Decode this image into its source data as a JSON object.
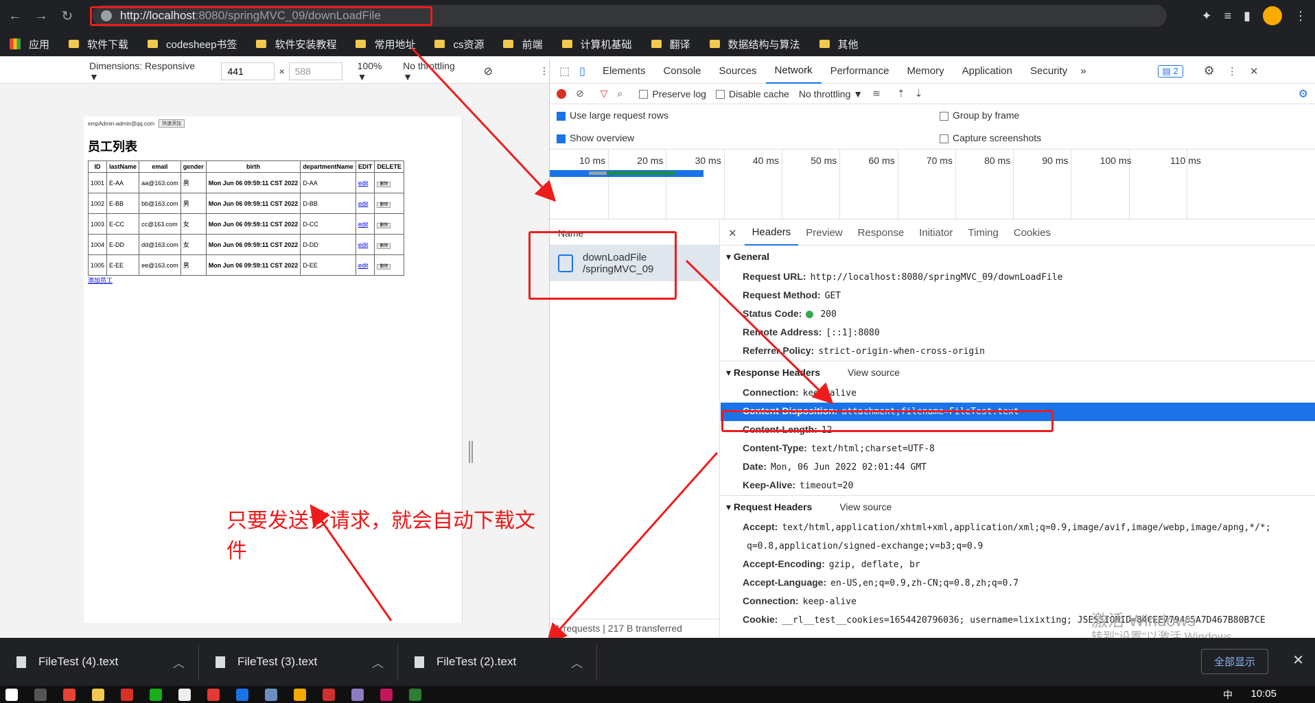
{
  "browser": {
    "url_host": "http://localhost",
    "url_rest": ":8080/springMVC_09/downLoadFile"
  },
  "bookmarks": [
    "应用",
    "软件下载",
    "codesheep书签",
    "软件安装教程",
    "常用地址",
    "cs资源",
    "前端",
    "计算机基础",
    "翻译",
    "数据结构与算法",
    "其他"
  ],
  "device_toolbar": {
    "dimensions": "Dimensions: Responsive ▼",
    "width": "441",
    "height": "588",
    "zoom": "100% ▼",
    "throttle": "No throttling ▼"
  },
  "page": {
    "user": "empAdmin-admin@qq.com",
    "quick_add": "快速添加",
    "title": "员工列表",
    "columns": [
      "ID",
      "lastName",
      "email",
      "gender",
      "birth",
      "departmentName",
      "EDIT",
      "DELETE"
    ],
    "rows": [
      [
        "1001",
        "E-AA",
        "aa@163.com",
        "男",
        "Mon Jun 06 09:59:11 CST 2022",
        "D-AA",
        "edit",
        "删除"
      ],
      [
        "1002",
        "E-BB",
        "bb@163.com",
        "男",
        "Mon Jun 06 09:59:11 CST 2022",
        "D-BB",
        "edit",
        "删除"
      ],
      [
        "1003",
        "E-CC",
        "cc@163.com",
        "女",
        "Mon Jun 06 09:59:11 CST 2022",
        "D-CC",
        "edit",
        "删除"
      ],
      [
        "1004",
        "E-DD",
        "dd@163.com",
        "女",
        "Mon Jun 06 09:59:11 CST 2022",
        "D-DD",
        "edit",
        "删除"
      ],
      [
        "1005",
        "E-EE",
        "ee@163.com",
        "男",
        "Mon Jun 06 09:59:11 CST 2022",
        "D-EE",
        "edit",
        "删除"
      ]
    ],
    "add_link": "添加员工"
  },
  "annotation": "只要发送该请求，就会自动下载文件",
  "devtools": {
    "tabs": [
      "Elements",
      "Console",
      "Sources",
      "Network",
      "Performance",
      "Memory",
      "Application",
      "Security"
    ],
    "active_tab": "Network",
    "issues_count": "2",
    "toolbar": {
      "preserve_log": "Preserve log",
      "disable_cache": "Disable cache",
      "throttle": "No throttling"
    },
    "options": {
      "large_rows": "Use large request rows",
      "show_overview": "Show overview",
      "group_by_frame": "Group by frame",
      "capture_screenshots": "Capture screenshots"
    },
    "timeline_ticks": [
      "10 ms",
      "20 ms",
      "30 ms",
      "40 ms",
      "50 ms",
      "60 ms",
      "70 ms",
      "80 ms",
      "90 ms",
      "100 ms",
      "110 ms"
    ],
    "name_header": "Name",
    "request_name": "downLoadFile",
    "request_path": "/springMVC_09",
    "footer": "1 requests  |  217 B transferred",
    "detail_tabs": [
      "Headers",
      "Preview",
      "Response",
      "Initiator",
      "Timing",
      "Cookies"
    ],
    "general": {
      "title": "General",
      "items": [
        {
          "k": "Request URL:",
          "v": "http://localhost:8080/springMVC_09/downLoadFile"
        },
        {
          "k": "Request Method:",
          "v": "GET"
        },
        {
          "k": "Status Code:",
          "v": "200"
        },
        {
          "k": "Remote Address:",
          "v": "[::1]:8080"
        },
        {
          "k": "Referrer Policy:",
          "v": "strict-origin-when-cross-origin"
        }
      ]
    },
    "response_headers": {
      "title": "Response Headers",
      "view_source": "View source",
      "items": [
        {
          "k": "Connection:",
          "v": "keep-alive"
        },
        {
          "k": "Content-Disposition:",
          "v": "attachment;filename=FileTest.text"
        },
        {
          "k": "Content-Length:",
          "v": "12"
        },
        {
          "k": "Content-Type:",
          "v": "text/html;charset=UTF-8"
        },
        {
          "k": "Date:",
          "v": "Mon, 06 Jun 2022 02:01:44 GMT"
        },
        {
          "k": "Keep-Alive:",
          "v": "timeout=20"
        }
      ]
    },
    "request_headers": {
      "title": "Request Headers",
      "view_source": "View source",
      "items": [
        {
          "k": "Accept:",
          "v": "text/html,application/xhtml+xml,application/xml;q=0.9,image/avif,image/webp,image/apng,*/*;"
        },
        {
          "k": "",
          "v": "q=0.8,application/signed-exchange;v=b3;q=0.9"
        },
        {
          "k": "Accept-Encoding:",
          "v": "gzip, deflate, br"
        },
        {
          "k": "Accept-Language:",
          "v": "en-US,en;q=0.9,zh-CN;q=0.8,zh;q=0.7"
        },
        {
          "k": "Connection:",
          "v": "keep-alive"
        },
        {
          "k": "Cookie:",
          "v": "__rl__test__cookies=1654420796036; username=lixixting; JSESSIONID=84CEE779465A7D467B80B7CE"
        }
      ]
    }
  },
  "downloads": [
    "FileTest (4).text",
    "FileTest (3).text",
    "FileTest (2).text"
  ],
  "show_all": "全部显示",
  "watermark": {
    "line1": "激活 Windows",
    "line2": "转到\"设置\"以激活 Windows。"
  },
  "clock": "10:05",
  "ime": "中",
  "colors": {
    "accent": "#1a73e8",
    "annotation": "#ee1c1c"
  }
}
